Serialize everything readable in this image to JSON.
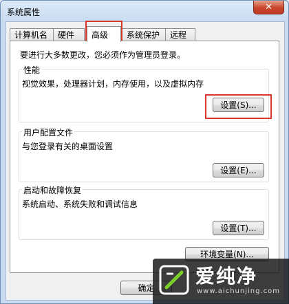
{
  "window": {
    "title": "系统属性",
    "close_label": "✕"
  },
  "tabs": [
    {
      "label": "计算机名"
    },
    {
      "label": "硬件"
    },
    {
      "label": "高级"
    },
    {
      "label": "系统保护"
    },
    {
      "label": "远程"
    }
  ],
  "active_tab": "高级",
  "notice": "要进行大多数更改，您必须作为管理员登录。",
  "performance": {
    "title": "性能",
    "description": "视觉效果，处理器计划，内存使用，以及虚拟内存",
    "button": "设置(S)..."
  },
  "user_profiles": {
    "title": "用户配置文件",
    "description": "与您登录有关的桌面设置",
    "button": "设置(E)..."
  },
  "startup_recovery": {
    "title": "启动和故障恢复",
    "description": "系统启动、系统失败和调试信息",
    "button": "设置(T)..."
  },
  "env_button": "环境变量(N)...",
  "footer": {
    "ok_label": "确定"
  },
  "watermark": {
    "name": "爱纯净",
    "url": "www.aichunjing.com"
  },
  "colors": {
    "highlight": "#d9362e",
    "window_frame": "#c9dcf1"
  }
}
